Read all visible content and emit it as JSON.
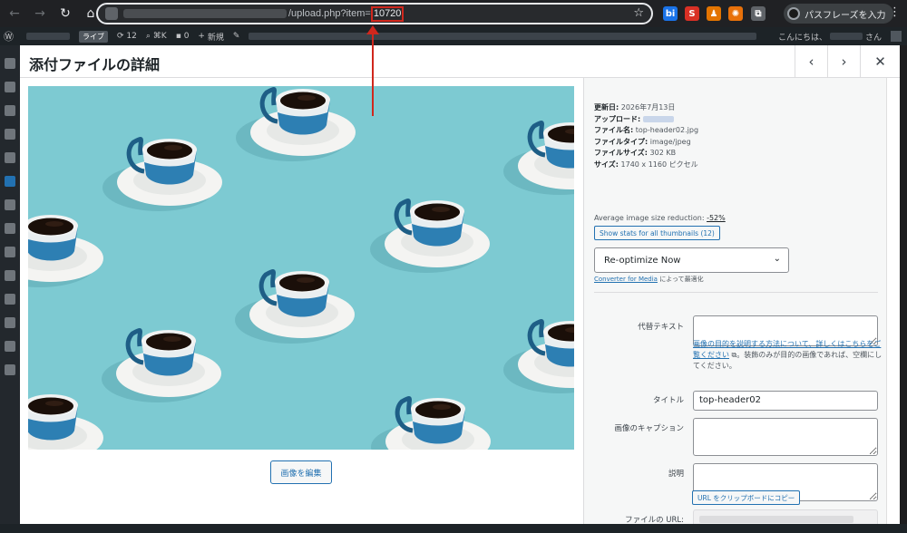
{
  "browser": {
    "url_path": "/upload.php?item=",
    "url_item_id": "10720",
    "extensions": [
      {
        "name": "bi-extension-icon",
        "label": "bi",
        "color": "#1a73e8"
      },
      {
        "name": "s-extension-icon",
        "label": "S",
        "color": "#d93025"
      },
      {
        "name": "person-extension-icon",
        "label": "♟",
        "color": "#e37400"
      },
      {
        "name": "sparkle-extension-icon",
        "label": "✺",
        "color": "#e8710a"
      },
      {
        "name": "puzzle-extension-icon",
        "label": "⧉",
        "color": "#5f6368"
      }
    ],
    "passphrase_button": "パスフレーズを入力"
  },
  "adminbar": {
    "live_badge": "ライブ",
    "updates_count": "12",
    "shortcut": "⌘K",
    "comments_count": "0",
    "new_label": "新規",
    "greeting": "こんにちは、",
    "greeting_suffix": "さん"
  },
  "modal": {
    "title": "添付ファイルの詳細",
    "prev_icon": "‹",
    "next_icon": "›",
    "close_icon": "✕",
    "edit_image_button": "画像を編集"
  },
  "details": {
    "updated_label": "更新日:",
    "updated_value": "2026年7月13日",
    "uploaded_label": "アップロード:",
    "filename_label": "ファイル名:",
    "filename_value": "top-header02.jpg",
    "filetype_label": "ファイルタイプ:",
    "filetype_value": "image/jpeg",
    "filesize_label": "ファイルサイズ:",
    "filesize_value": "302 KB",
    "dimensions_label": "サイズ:",
    "dimensions_value": "1740 x 1160 ピクセル",
    "avg_reduction_label": "Average image size reduction:",
    "avg_reduction_value": "-52%",
    "stats_button": "Show stats for all thumbnails (12)",
    "reoptimize_select": "Re-optimize Now",
    "converter_link": "Converter for Media",
    "converter_suffix": "によって最適化"
  },
  "form": {
    "alt_label": "代替テキスト",
    "alt_value": "",
    "help_link": "画像の目的を説明する方法について、詳しくはこちらをご覧ください",
    "help_text": "。装飾のみが目的の画像であれば、空欄にしてください。",
    "title_label": "タイトル",
    "title_value": "top-header02",
    "caption_label": "画像のキャプション",
    "caption_value": "",
    "description_label": "説明",
    "description_value": "",
    "file_url_label": "ファイルの URL:",
    "copy_url_button": "URL をクリップボードにコピー"
  },
  "colors": {
    "image_background": "#7dcad2",
    "annotation_red": "#d0271d",
    "wp_blue": "#2271b1"
  }
}
